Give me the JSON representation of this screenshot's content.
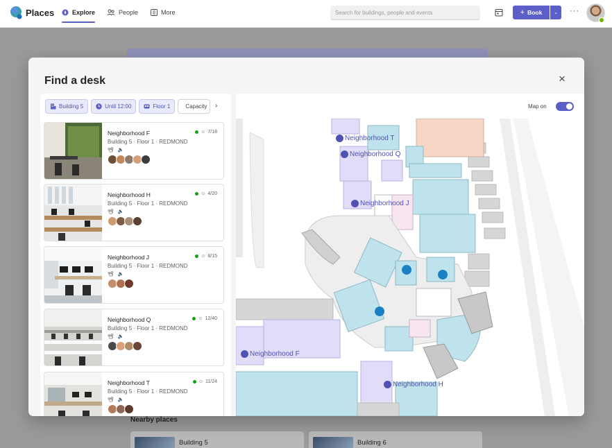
{
  "app": {
    "title": "Places"
  },
  "nav": [
    {
      "label": "Explore",
      "active": true
    },
    {
      "label": "People",
      "active": false
    },
    {
      "label": "More",
      "active": false
    }
  ],
  "search": {
    "placeholder": "Search for buildings, people and events"
  },
  "toolbar": {
    "book_label": "Book",
    "more_label": "···"
  },
  "colors": {
    "accent": "#5b5fc7",
    "available": "#13a10e"
  },
  "modal": {
    "title": "Find a desk",
    "close_label": "×",
    "filters": [
      {
        "label": "Building 5",
        "icon": "building-icon"
      },
      {
        "label": "Until 12:00",
        "icon": "clock-icon"
      },
      {
        "label": "Floor 1",
        "icon": "floor-icon"
      },
      {
        "label": "Capacity",
        "icon": "person-icon"
      }
    ],
    "filter_more": "›",
    "map_toggle_label": "Map on",
    "map_on": true
  },
  "neighborhoods": [
    {
      "name": "Neighborhood F",
      "location": "Building 5 · Floor 1 · REDMOND",
      "amenities": "📽 🔈",
      "availability": "7/18",
      "people_count": 5
    },
    {
      "name": "Neighborhood H",
      "location": "Building 5 · Floor 1 · REDMOND",
      "amenities": "📽 🔈",
      "availability": "4/20",
      "people_count": 4
    },
    {
      "name": "Neighborhood J",
      "location": "Building 5 · Floor 1 · REDMOND",
      "amenities": "📽 🔈",
      "availability": "8/15",
      "people_count": 3
    },
    {
      "name": "Neighborhood Q",
      "location": "Building 5 · Floor 1 · REDMOND",
      "amenities": "📽 🔈",
      "availability": "12/40",
      "people_count": 4
    },
    {
      "name": "Neighborhood T",
      "location": "Building 5 · Floor 1 · REDMOND",
      "amenities": "📽 🔈",
      "availability": "11/24",
      "people_count": 3
    }
  ],
  "map_labels": [
    {
      "label": "Neighborhood T"
    },
    {
      "label": "Neighborhood Q"
    },
    {
      "label": "Neighborhood J"
    },
    {
      "label": "Neighborhood F"
    },
    {
      "label": "Neighborhood H"
    }
  ],
  "background": {
    "nearby_title": "Nearby places",
    "cards": [
      {
        "label": "Building 5"
      },
      {
        "label": "Building 6"
      }
    ]
  }
}
